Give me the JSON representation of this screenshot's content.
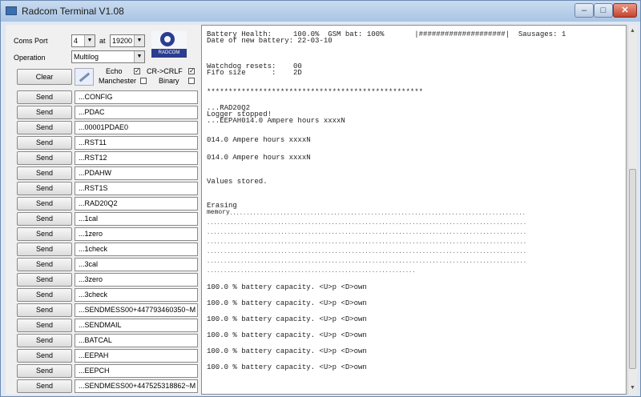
{
  "window": {
    "title": "Radcom Terminal V1.08"
  },
  "controls": {
    "coms_port_label": "Coms Port",
    "port_value": "4",
    "at_label": "at",
    "baud_value": "19200",
    "operation_label": "Operation",
    "operation_value": "Multilog",
    "clear_label": "Clear",
    "echo_label": "Echo",
    "crlf_label": "CR->CRLF",
    "manchester_label": "Manchester",
    "binary_label": "Binary",
    "logo_text": "RADCOM"
  },
  "send_label": "Send",
  "commands": [
    "...CONFIG",
    "...PDAC",
    "...00001PDAE0",
    "...RST11",
    "...RST12",
    "...PDAHW",
    "...RST1S",
    "...RAD20Q2",
    "...1cal",
    "...1zero",
    "...1check",
    "...3cal",
    "...3zero",
    "...3check",
    "...SENDMESS00+447793460350~M",
    "...SENDMAIL",
    "...BATCAL",
    "...EEPAH",
    "...EEPCH",
    "...SENDMESS00+447525318862~M"
  ],
  "terminal": {
    "lines": [
      "Battery Health:     100.0%  GSM bat: 100%       |####################|  Sausages: 1",
      "Date of new battery: 22-03-10",
      "Watchdog resets:    00",
      "Fifo size      :    2D",
      "**************************************************",
      "...RAD20Q2",
      "Logger stopped!",
      "...EEPAH014.0 Ampere hours xxxxN",
      "014.0 Ampere hours xxxxN",
      "014.0 Ampere hours xxxxN",
      "Values stored.",
      "Erasing",
      "memory",
      "100.0 % battery capacity. <U>p <D>own",
      "100.0 % battery capacity. <U>p <D>own",
      "100.0 % battery capacity. <U>p <D>own",
      "100.0 % battery capacity. <U>p <D>own",
      "100.0 % battery capacity. <U>p <D>own",
      "100.0 % battery capacity. <U>p <D>own"
    ]
  }
}
